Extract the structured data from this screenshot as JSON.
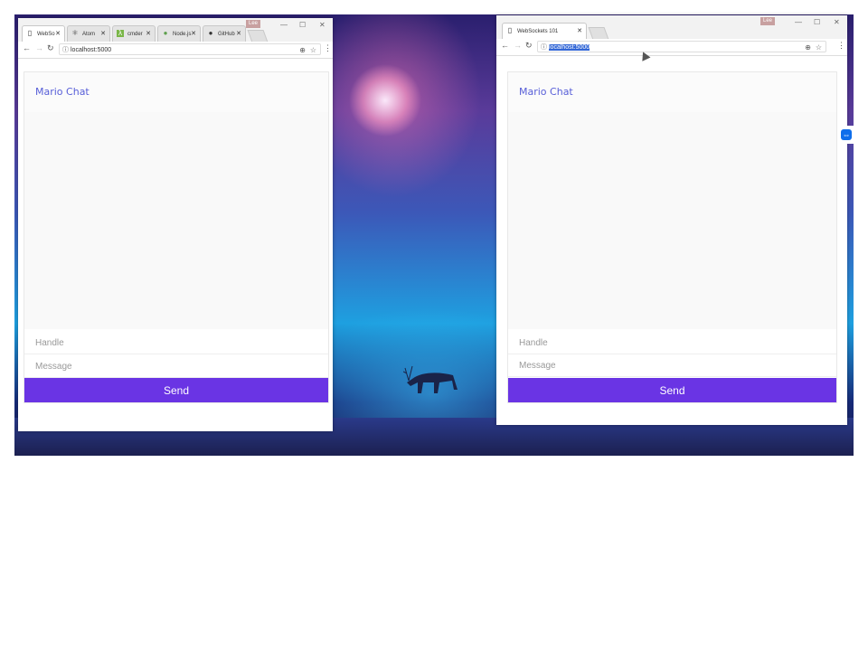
{
  "left_window": {
    "tabs": [
      {
        "label": "WebSo",
        "icon": "page-icon",
        "active": true
      },
      {
        "label": "Atom",
        "icon": "atom-icon",
        "active": false
      },
      {
        "label": "cmder",
        "icon": "cmder-icon",
        "active": false
      },
      {
        "label": "Node.js",
        "icon": "node-icon",
        "active": false
      },
      {
        "label": "GitHub",
        "icon": "github-icon",
        "active": false
      }
    ],
    "profile_label": "Lee",
    "url": "localhost:5000",
    "chat": {
      "title": "Mario Chat",
      "handle_placeholder": "Handle",
      "message_placeholder": "Message",
      "send_label": "Send"
    }
  },
  "right_window": {
    "tabs": [
      {
        "label": "WebSockets 101",
        "icon": "page-icon",
        "active": true
      }
    ],
    "profile_label": "Lee",
    "url": "localhost:5000",
    "chat": {
      "title": "Mario Chat",
      "handle_placeholder": "Handle",
      "message_placeholder": "Message",
      "send_label": "Send"
    }
  },
  "colors": {
    "chat_title": "#575ed8",
    "send_button": "#6a34e4"
  }
}
